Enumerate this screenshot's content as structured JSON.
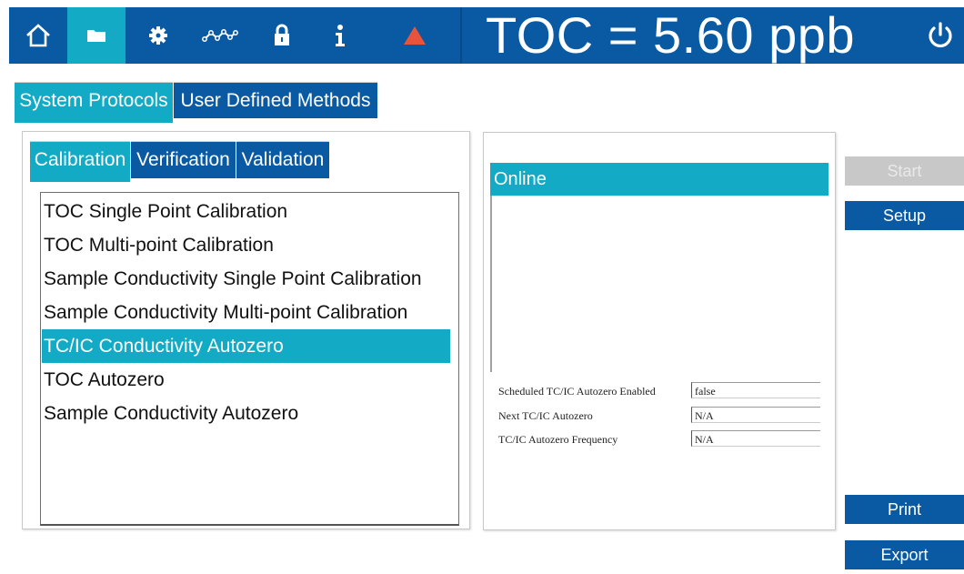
{
  "nav": {
    "icons": [
      "home-icon",
      "folder-icon",
      "gear-icon",
      "trend-icon",
      "lock-icon",
      "info-icon",
      "alarm-icon"
    ],
    "active_index": 1
  },
  "status": {
    "toc_reading": "TOC = 5.60 ppb"
  },
  "colors": {
    "header_blue": "#0a5aa3",
    "accent_teal": "#12aac4",
    "alarm_red": "#e8543b",
    "disabled_gray": "#c8c8c8"
  },
  "main_tabs": [
    {
      "label": "System Protocols",
      "selected": true
    },
    {
      "label": "User Defined Methods",
      "selected": false
    }
  ],
  "sub_tabs": [
    {
      "label": "Calibration",
      "selected": true
    },
    {
      "label": "Verification",
      "selected": false
    },
    {
      "label": "Validation",
      "selected": false
    }
  ],
  "protocols": [
    {
      "label": "TOC Single Point Calibration",
      "selected": false
    },
    {
      "label": "TOC Multi-point Calibration",
      "selected": false
    },
    {
      "label": "Sample Conductivity Single Point Calibration",
      "selected": false
    },
    {
      "label": "Sample Conductivity Multi-point Calibration",
      "selected": false
    },
    {
      "label": "TC/IC Conductivity Autozero",
      "selected": true
    },
    {
      "label": "TOC Autozero",
      "selected": false
    },
    {
      "label": "Sample Conductivity Autozero",
      "selected": false
    }
  ],
  "details": {
    "mode_header": "Online",
    "properties": [
      {
        "label": "Scheduled TC/IC Autozero Enabled",
        "value": "false"
      },
      {
        "label": "Next TC/IC Autozero",
        "value": "N/A"
      },
      {
        "label": "TC/IC Autozero Frequency",
        "value": "N/A"
      }
    ]
  },
  "actions": {
    "start": {
      "label": "Start",
      "enabled": false
    },
    "setup": {
      "label": "Setup",
      "enabled": true
    },
    "print": {
      "label": "Print",
      "enabled": true
    },
    "export": {
      "label": "Export",
      "enabled": true
    }
  }
}
